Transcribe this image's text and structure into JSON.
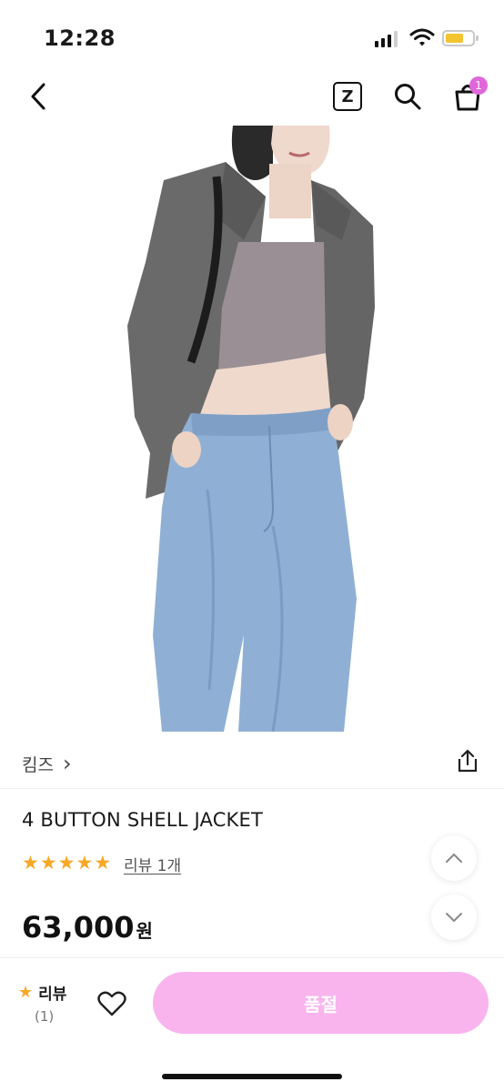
{
  "status_bar": {
    "time": "12:28",
    "battery_color": "#f4c430"
  },
  "nav": {
    "z_label": "Z",
    "cart_count": "1",
    "icons": [
      "back-arrow-icon",
      "z-icon",
      "search-icon",
      "shopping-bag-icon"
    ]
  },
  "product": {
    "brand": "킴즈",
    "brand_arrow": "›",
    "title": "4 BUTTON SHELL JACKET",
    "rating_stars": 5,
    "review_link": "리뷰 1개",
    "price": "63,000",
    "currency": "원"
  },
  "bottom_bar": {
    "review_label": "리뷰",
    "review_count": "(1)",
    "soldout_label": "품절",
    "soldout_color": "#f9b4ee"
  },
  "colors": {
    "accent": "#e066d9",
    "star": "#f7a825"
  }
}
